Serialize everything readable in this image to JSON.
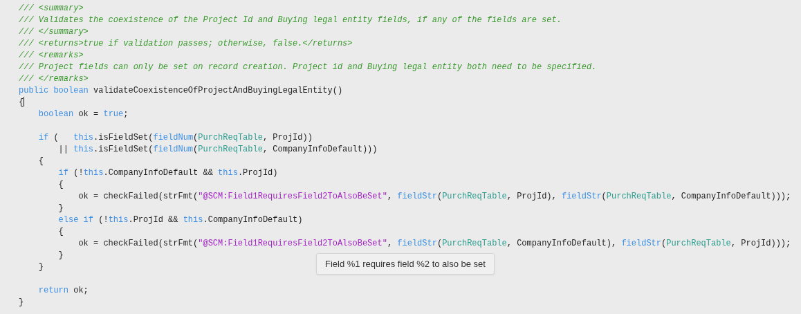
{
  "editor": {
    "lines": [
      {
        "kind": "code",
        "tokens": [
          {
            "kind": "comment",
            "text": "/// <summary>"
          }
        ]
      },
      {
        "kind": "code",
        "tokens": [
          {
            "kind": "comment",
            "text": "/// Validates the coexistence of the Project Id and Buying legal entity fields, if any of the fields are set."
          }
        ]
      },
      {
        "kind": "code",
        "tokens": [
          {
            "kind": "comment",
            "text": "/// </summary>"
          }
        ]
      },
      {
        "kind": "code",
        "tokens": [
          {
            "kind": "comment",
            "text": "/// <returns>true if validation passes; otherwise, false.</returns>"
          }
        ]
      },
      {
        "kind": "code",
        "tokens": [
          {
            "kind": "comment",
            "text": "/// <remarks>"
          }
        ]
      },
      {
        "kind": "code",
        "tokens": [
          {
            "kind": "comment",
            "text": "/// Project fields can only be set on record creation. Project id and Buying legal entity both need to be specified."
          }
        ]
      },
      {
        "kind": "code",
        "tokens": [
          {
            "kind": "comment",
            "text": "/// </remarks>"
          }
        ]
      },
      {
        "kind": "code",
        "tokens": [
          {
            "kind": "keyword",
            "text": "public boolean"
          },
          {
            "kind": "plain",
            "text": " validateCoexistenceOfProjectAndBuyingLegalEntity()"
          }
        ]
      },
      {
        "kind": "code",
        "caret": true,
        "tokens": [
          {
            "kind": "plain",
            "text": "{"
          }
        ]
      },
      {
        "kind": "code",
        "tokens": [
          {
            "kind": "keyword",
            "text": "    boolean"
          },
          {
            "kind": "plain",
            "text": " ok = "
          },
          {
            "kind": "keyword",
            "text": "true"
          },
          {
            "kind": "plain",
            "text": ";"
          }
        ]
      },
      {
        "kind": "blank"
      },
      {
        "kind": "code",
        "tokens": [
          {
            "kind": "keyword",
            "text": "    if"
          },
          {
            "kind": "plain",
            "text": " (   "
          },
          {
            "kind": "keyword",
            "text": "this"
          },
          {
            "kind": "plain",
            "text": ".isFieldSet("
          },
          {
            "kind": "keyword",
            "text": "fieldNum"
          },
          {
            "kind": "plain",
            "text": "("
          },
          {
            "kind": "type",
            "text": "PurchReqTable"
          },
          {
            "kind": "plain",
            "text": ", ProjId))"
          }
        ]
      },
      {
        "kind": "code",
        "tokens": [
          {
            "kind": "plain",
            "text": "        || "
          },
          {
            "kind": "keyword",
            "text": "this"
          },
          {
            "kind": "plain",
            "text": ".isFieldSet("
          },
          {
            "kind": "keyword",
            "text": "fieldNum"
          },
          {
            "kind": "plain",
            "text": "("
          },
          {
            "kind": "type",
            "text": "PurchReqTable"
          },
          {
            "kind": "plain",
            "text": ", CompanyInfoDefault)))"
          }
        ]
      },
      {
        "kind": "code",
        "tokens": [
          {
            "kind": "plain",
            "text": "    {"
          }
        ]
      },
      {
        "kind": "code",
        "tokens": [
          {
            "kind": "keyword",
            "text": "        if"
          },
          {
            "kind": "plain",
            "text": " (!"
          },
          {
            "kind": "keyword",
            "text": "this"
          },
          {
            "kind": "plain",
            "text": ".CompanyInfoDefault && "
          },
          {
            "kind": "keyword",
            "text": "this"
          },
          {
            "kind": "plain",
            "text": ".ProjId)"
          }
        ]
      },
      {
        "kind": "code",
        "tokens": [
          {
            "kind": "plain",
            "text": "        {"
          }
        ]
      },
      {
        "kind": "code",
        "tokens": [
          {
            "kind": "plain",
            "text": "            ok = checkFailed(strFmt("
          },
          {
            "kind": "string",
            "text": "\"@SCM:Field1RequiresField2ToAlsoBeSet\""
          },
          {
            "kind": "plain",
            "text": ", "
          },
          {
            "kind": "keyword",
            "text": "fieldStr"
          },
          {
            "kind": "plain",
            "text": "("
          },
          {
            "kind": "type",
            "text": "PurchReqTable"
          },
          {
            "kind": "plain",
            "text": ", ProjId), "
          },
          {
            "kind": "keyword",
            "text": "fieldStr"
          },
          {
            "kind": "plain",
            "text": "("
          },
          {
            "kind": "type",
            "text": "PurchReqTable"
          },
          {
            "kind": "plain",
            "text": ", CompanyInfoDefault)));"
          }
        ]
      },
      {
        "kind": "code",
        "tokens": [
          {
            "kind": "plain",
            "text": "        }"
          }
        ]
      },
      {
        "kind": "code",
        "tokens": [
          {
            "kind": "keyword",
            "text": "        else if"
          },
          {
            "kind": "plain",
            "text": " (!"
          },
          {
            "kind": "keyword",
            "text": "this"
          },
          {
            "kind": "plain",
            "text": ".ProjId && "
          },
          {
            "kind": "keyword",
            "text": "this"
          },
          {
            "kind": "plain",
            "text": ".CompanyInfoDefault)"
          }
        ]
      },
      {
        "kind": "code",
        "tokens": [
          {
            "kind": "plain",
            "text": "        {"
          }
        ]
      },
      {
        "kind": "code",
        "tokens": [
          {
            "kind": "plain",
            "text": "            ok = checkFailed(strFmt("
          },
          {
            "kind": "string",
            "text": "\"@SCM:Field1RequiresField2ToAlsoBeSet\""
          },
          {
            "kind": "plain",
            "text": ", "
          },
          {
            "kind": "keyword",
            "text": "fieldStr"
          },
          {
            "kind": "plain",
            "text": "("
          },
          {
            "kind": "type",
            "text": "PurchReqTable"
          },
          {
            "kind": "plain",
            "text": ", CompanyInfoDefault), "
          },
          {
            "kind": "keyword",
            "text": "fieldStr"
          },
          {
            "kind": "plain",
            "text": "("
          },
          {
            "kind": "type",
            "text": "PurchReqTable"
          },
          {
            "kind": "plain",
            "text": ", ProjId)));"
          }
        ]
      },
      {
        "kind": "code",
        "tokens": [
          {
            "kind": "plain",
            "text": "        }"
          }
        ]
      },
      {
        "kind": "code",
        "tokens": [
          {
            "kind": "plain",
            "text": "    }"
          }
        ]
      },
      {
        "kind": "blank"
      },
      {
        "kind": "code",
        "tokens": [
          {
            "kind": "keyword",
            "text": "    return"
          },
          {
            "kind": "plain",
            "text": " ok;"
          }
        ]
      },
      {
        "kind": "code",
        "tokens": [
          {
            "kind": "plain",
            "text": "}"
          }
        ]
      }
    ]
  },
  "tooltip": {
    "text": "Field %1 requires field %2 to also be set"
  }
}
